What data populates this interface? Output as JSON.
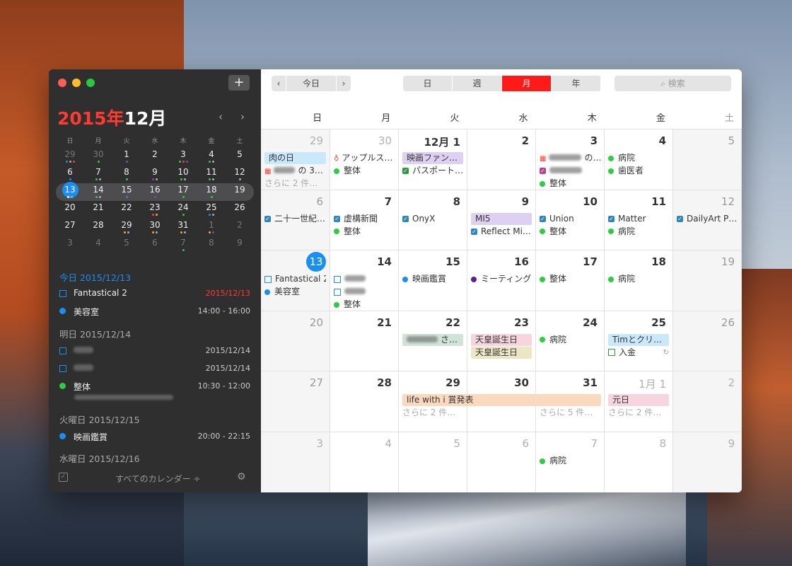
{
  "window_title_month": {
    "year": "2015年",
    "month": "12月"
  },
  "toolbar": {
    "add": "+",
    "prev": "‹",
    "today": "今日",
    "next": "›",
    "views": [
      "日",
      "週",
      "月",
      "年"
    ],
    "active_view": "月",
    "search_placeholder": "検索"
  },
  "mini_calendar": {
    "weekdays": [
      "日",
      "月",
      "火",
      "水",
      "木",
      "金",
      "土"
    ],
    "weeks": [
      [
        {
          "d": "29",
          "om": true,
          "dots": [
            "#1b8ef2",
            "#aaa",
            "#ff3b30"
          ]
        },
        {
          "d": "30",
          "om": true,
          "dots": [
            "#2ecc40"
          ]
        },
        {
          "d": "1",
          "dots": [
            "#8e44ad"
          ]
        },
        {
          "d": "2",
          "dots": []
        },
        {
          "d": "3",
          "dots": [
            "#2ecc40",
            "#ff3b30",
            "#8e44ad"
          ]
        },
        {
          "d": "4",
          "dots": [
            "#2ecc40",
            "#aaa"
          ]
        },
        {
          "d": "5",
          "dots": []
        }
      ],
      [
        {
          "d": "6",
          "dots": [
            "#1b8ef2"
          ]
        },
        {
          "d": "7",
          "dots": [
            "#2ecc40",
            "#aaa"
          ]
        },
        {
          "d": "8",
          "dots": [
            "#2ecc40"
          ]
        },
        {
          "d": "9",
          "dots": [
            "#8e44ad",
            "#aaa"
          ]
        },
        {
          "d": "10",
          "dots": [
            "#2ecc40",
            "#aaa"
          ]
        },
        {
          "d": "11",
          "dots": [
            "#2ecc40",
            "#aaa"
          ]
        },
        {
          "d": "12",
          "dots": [
            "#aaa"
          ]
        }
      ],
      [
        {
          "d": "13",
          "sel": true,
          "dots": [
            "#fff",
            "#aaa"
          ]
        },
        {
          "d": "14",
          "dots": [
            "#2ecc40",
            "#aaa"
          ]
        },
        {
          "d": "15",
          "dots": [
            "#1b8ef2"
          ]
        },
        {
          "d": "16",
          "dots": [
            "#8e44ad"
          ]
        },
        {
          "d": "17",
          "dots": [
            "#2ecc40"
          ]
        },
        {
          "d": "18",
          "dots": [
            "#2ecc40"
          ]
        },
        {
          "d": "19",
          "dots": []
        }
      ],
      [
        {
          "d": "20",
          "dots": []
        },
        {
          "d": "21",
          "dots": []
        },
        {
          "d": "22",
          "dots": []
        },
        {
          "d": "23",
          "dots": [
            "#ff3b30",
            "#e8a93a"
          ]
        },
        {
          "d": "24",
          "dots": [
            "#2ecc40"
          ]
        },
        {
          "d": "25",
          "dots": [
            "#1b8ef2",
            "#aaa"
          ]
        },
        {
          "d": "26",
          "dots": []
        }
      ],
      [
        {
          "d": "27",
          "dots": []
        },
        {
          "d": "28",
          "dots": []
        },
        {
          "d": "29",
          "dots": [
            "#e8a93a",
            "#aaa"
          ]
        },
        {
          "d": "30",
          "dots": [
            "#e8a93a",
            "#aaa"
          ]
        },
        {
          "d": "31",
          "dots": [
            "#e8a93a",
            "#aaa"
          ]
        },
        {
          "d": "1",
          "om": true,
          "dots": [
            "#e8a93a",
            "#8e44ad"
          ]
        },
        {
          "d": "2",
          "om": true,
          "dots": []
        }
      ],
      [
        {
          "d": "3",
          "om": true,
          "dots": []
        },
        {
          "d": "4",
          "om": true,
          "dots": []
        },
        {
          "d": "5",
          "om": true,
          "dots": []
        },
        {
          "d": "6",
          "om": true,
          "dots": []
        },
        {
          "d": "7",
          "om": true,
          "dots": [
            "#2ecc40"
          ]
        },
        {
          "d": "8",
          "om": true,
          "dots": []
        },
        {
          "d": "9",
          "om": true,
          "dots": []
        }
      ]
    ]
  },
  "agenda": {
    "today_header": "今日 2015/12/13",
    "today_items": [
      {
        "type": "task",
        "title": "Fantastical 2",
        "right": "2015/12/13",
        "right_color": "#ff3b30"
      },
      {
        "type": "event",
        "title": "美容室",
        "right": "14:00 - 16:00",
        "color": "#1b8ef2"
      }
    ],
    "tomorrow_header": "明日 2015/12/14",
    "tomorrow_items": [
      {
        "type": "task",
        "title": "",
        "right": "2015/12/14"
      },
      {
        "type": "task",
        "title": "",
        "right": "2015/12/14"
      },
      {
        "type": "event",
        "title": "整体",
        "right": "10:30 - 12:00",
        "color": "#2ecc40"
      }
    ],
    "tue_header": "火曜日 2015/12/15",
    "tue_items": [
      {
        "type": "event",
        "title": "映画鑑賞",
        "right": "20:00 - 22:15",
        "color": "#1b8ef2"
      }
    ],
    "wed_header": "水曜日 2015/12/16"
  },
  "sidebar_bottom": {
    "calendars": "すべてのカレンダー ÷",
    "gear": "⚙"
  },
  "month": {
    "weekdays": [
      "日",
      "月",
      "火",
      "水",
      "木",
      "金",
      "土"
    ],
    "weeks": [
      [
        "29",
        "30",
        "12月 1",
        "2",
        "3",
        "4",
        "5"
      ],
      [
        "6",
        "7",
        "8",
        "9",
        "10",
        "11",
        "12"
      ],
      [
        "13",
        "14",
        "15",
        "16",
        "17",
        "18",
        "19"
      ],
      [
        "20",
        "21",
        "22",
        "23",
        "24",
        "25",
        "26"
      ],
      [
        "27",
        "28",
        "29",
        "30",
        "31",
        "1月 1",
        "2"
      ],
      [
        "3",
        "4",
        "5",
        "6",
        "7",
        "8",
        "9"
      ]
    ],
    "events": {
      "w0": {
        "sun": {
          "bar": "肉の日",
          "sub": "の 3…",
          "more": "さらに 2 件…"
        },
        "mon": {
          "a": "アップルス…",
          "b": "整体"
        },
        "tue": {
          "bar": "映画ファン…",
          "b": "パスポート…"
        },
        "thu": {
          "a": "の…",
          "c": "整体"
        },
        "fri": {
          "a": "病院",
          "b": "歯医者"
        }
      },
      "w1": {
        "sun": "二十一世紀…",
        "mon": {
          "a": "虚構新聞",
          "b": "整体"
        },
        "tue": "OnyX",
        "wed": {
          "bar": "MI5",
          "b": "Reflect Mi…"
        },
        "thu": {
          "a": "Union",
          "b": "整体"
        },
        "fri": {
          "a": "Matter",
          "b": "病院"
        },
        "sat": "DailyArt P…"
      },
      "w2": {
        "sun": {
          "a": "Fantastical 2",
          "b": "美容室"
        },
        "mon": {
          "c": "整体"
        },
        "tue": "映画鑑賞",
        "wed": "ミーティング",
        "thu": "整体",
        "fri": "病院"
      },
      "w3": {
        "tue": "さ…",
        "wed": {
          "a": "天皇誕生日",
          "b": "天皇誕生日"
        },
        "thu": "病院",
        "fri": {
          "a": "Timとクリ…",
          "b": "入金"
        }
      },
      "w4": {
        "span": "life with i 賞発表",
        "tue_more": "さらに 2 件…",
        "thu_more": "さらに 5 件…",
        "fri": "元日",
        "fri_more": "さらに 2 件…"
      },
      "w5": {
        "thu": "病院"
      }
    }
  }
}
